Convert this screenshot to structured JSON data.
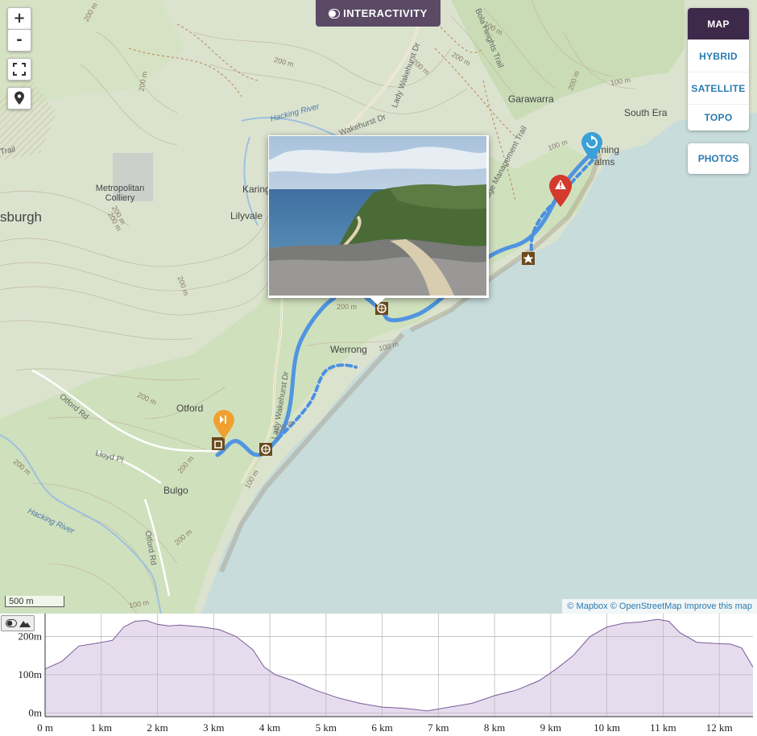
{
  "controls": {
    "zoom_in": "+",
    "zoom_out": "-",
    "interactivity_label": "INTERACTIVITY",
    "layers": [
      "MAP",
      "HYBRID",
      "SATELLITE",
      "TOPO"
    ],
    "active_layer": "MAP",
    "photos_label": "PHOTOS"
  },
  "map_labels": {
    "places": [
      "Garawarra",
      "South Era",
      "Metropolitan Colliery",
      "Karing",
      "Lilyvale",
      "Werrong",
      "Otford",
      "Bulgo",
      "ming",
      "alms"
    ],
    "partial_town": "sburgh",
    "roads": [
      "Lady Wakehurst Dr",
      "Wakehurst Dr",
      "Bola Heights Trail",
      "Ridge Management Trail",
      "Otford Rd",
      "Lloyd Pl",
      "Lady Wakehurst Dr",
      "Trail"
    ],
    "water": [
      "Hacking River",
      "Hacking River"
    ],
    "contours": [
      "200 m",
      "200 m",
      "200 m",
      "200 m",
      "200 m",
      "100 m",
      "100 m",
      "100 m",
      "200 m",
      "200 m",
      "200 m",
      "200 m",
      "200 m",
      "200 m",
      "200 m",
      "100 m",
      "100 m",
      "200 m",
      "200 m",
      "100 m",
      "200 m",
      "200 m",
      "200 m",
      "100 m",
      "200 m"
    ]
  },
  "scale_label": "500 m",
  "attribution": {
    "mapbox": "© Mapbox",
    "osm": "© OpenStreetMap",
    "improve": "Improve this map"
  },
  "colors": {
    "route": "#4a90e2",
    "start_marker": "#f0a030",
    "end_marker": "#3aa0d8",
    "warning_marker": "#d33a2c",
    "poi": "#6b4a1e",
    "sea": "#c8dcdc",
    "land": "#dbe3cf",
    "elevation_fill": "#e6dcee",
    "elevation_line": "#7a5a9a",
    "interactivity_bg": "#5a4a66"
  },
  "chart_data": {
    "type": "area",
    "title": "",
    "xlabel": "",
    "ylabel": "",
    "x_ticks": [
      "0 m",
      "1 km",
      "2 km",
      "3 km",
      "4 km",
      "5 km",
      "6 km",
      "7 km",
      "8 km",
      "9 km",
      "10 km",
      "11 km",
      "12 km"
    ],
    "y_ticks": [
      "0m",
      "100m",
      "200m"
    ],
    "xlim": [
      0,
      12.6
    ],
    "ylim": [
      -10,
      260
    ],
    "x": [
      0,
      0.3,
      0.6,
      0.9,
      1.2,
      1.4,
      1.6,
      1.8,
      2.0,
      2.2,
      2.4,
      2.8,
      3.1,
      3.4,
      3.7,
      3.9,
      4.1,
      4.4,
      4.8,
      5.2,
      5.6,
      6.0,
      6.4,
      6.8,
      7.2,
      7.6,
      8.0,
      8.4,
      8.8,
      9.1,
      9.4,
      9.7,
      10.0,
      10.3,
      10.6,
      10.9,
      11.1,
      11.3,
      11.6,
      11.9,
      12.2,
      12.4,
      12.6
    ],
    "y": [
      115,
      135,
      175,
      182,
      190,
      225,
      240,
      242,
      232,
      228,
      230,
      225,
      218,
      200,
      165,
      120,
      100,
      85,
      60,
      40,
      25,
      15,
      12,
      5,
      15,
      25,
      45,
      60,
      85,
      115,
      150,
      200,
      225,
      235,
      238,
      245,
      240,
      210,
      185,
      182,
      180,
      170,
      120
    ]
  }
}
